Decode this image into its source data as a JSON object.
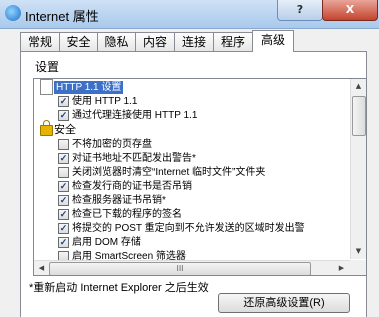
{
  "window": {
    "title": "Internet 属性",
    "help_label": "?",
    "close_label": "X"
  },
  "tabs": [
    "常规",
    "安全",
    "隐私",
    "内容",
    "连接",
    "程序",
    "高级"
  ],
  "active_tab": "高级",
  "settings_label": "设置",
  "list": [
    {
      "type": "group",
      "icon": "document-icon",
      "label": "HTTP 1.1 设置",
      "selected": true
    },
    {
      "type": "checkbox",
      "checked": true,
      "label": "使用 HTTP 1.1"
    },
    {
      "type": "checkbox",
      "checked": true,
      "label": "通过代理连接使用 HTTP 1.1"
    },
    {
      "type": "group",
      "icon": "lock-icon",
      "label": "安全",
      "selected": false
    },
    {
      "type": "checkbox",
      "checked": false,
      "label": "不将加密的页存盘"
    },
    {
      "type": "checkbox",
      "checked": true,
      "label": "对证书地址不匹配发出警告*"
    },
    {
      "type": "checkbox",
      "checked": false,
      "label": "关闭浏览器时清空“Internet 临时文件”文件夹"
    },
    {
      "type": "checkbox",
      "checked": true,
      "label": "检查发行商的证书是否吊销"
    },
    {
      "type": "checkbox",
      "checked": true,
      "label": "检查服务器证书吊销*"
    },
    {
      "type": "checkbox",
      "checked": true,
      "label": "检查已下载的程序的签名"
    },
    {
      "type": "checkbox",
      "checked": true,
      "label": "将提交的 POST 重定向到不允许发送的区域时发出警"
    },
    {
      "type": "checkbox",
      "checked": true,
      "label": "启用 DOM 存储"
    },
    {
      "type": "checkbox",
      "checked": false,
      "label": "启用 SmartScreen 筛选器"
    }
  ],
  "hscroll_grip": "III",
  "note": "*重新启动 Internet Explorer 之后生效",
  "restore_button": "还原高级设置(R)"
}
